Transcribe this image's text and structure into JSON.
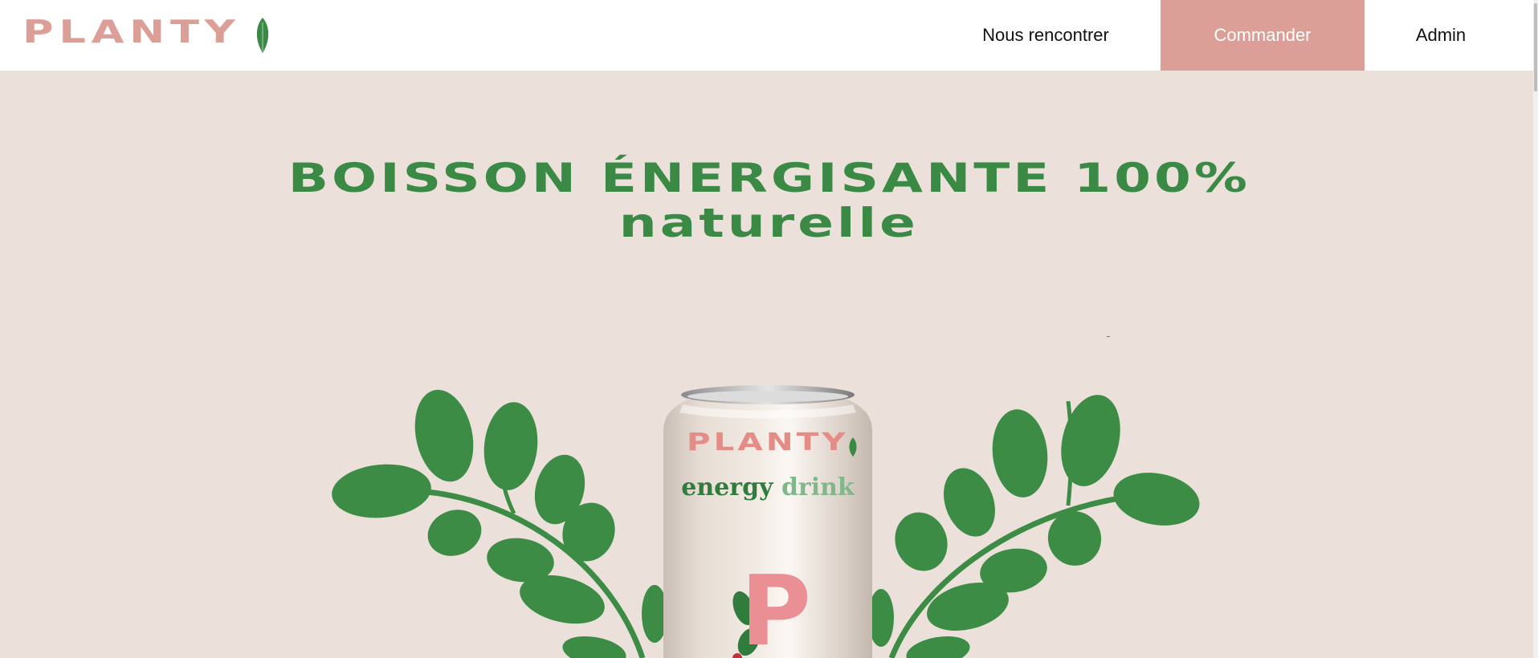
{
  "header": {
    "logo_text": "PLANTY",
    "nav": [
      {
        "label": "Nous rencontrer"
      },
      {
        "label": "Commander"
      },
      {
        "label": "Admin"
      }
    ]
  },
  "hero": {
    "title_line1": "BOISSON ÉNERGISANTE 100%",
    "title_line2": "naturelle"
  },
  "product": {
    "brand": "PLANTY",
    "subtitle_dark": "energy",
    "subtitle_light": "drink",
    "initial": "P"
  },
  "colors": {
    "brand_pink": "#dc9f98",
    "brand_green": "#3a8a46",
    "background": "#ebe1da"
  },
  "icons": [
    "leaf-icon"
  ]
}
